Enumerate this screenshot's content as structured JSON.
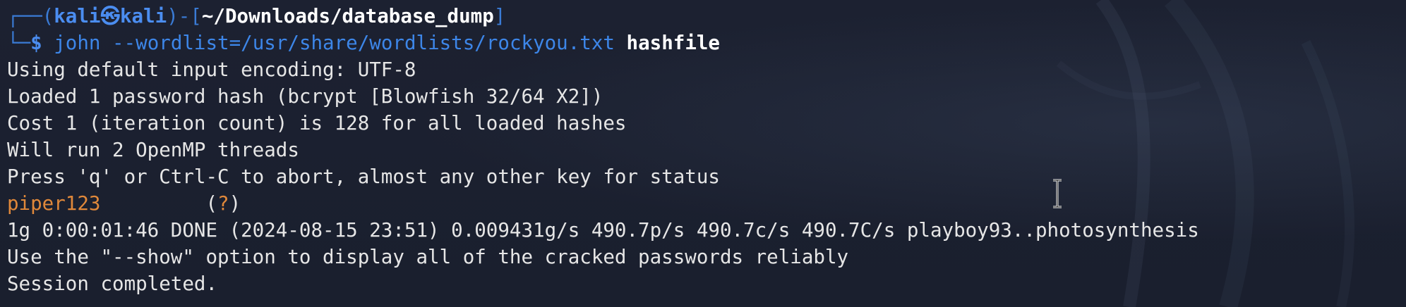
{
  "prompt": {
    "corner_top": "┌──(",
    "user": "kali",
    "at_symbol": "㉿",
    "host": "kali",
    "sep_open": ")-[",
    "path": "~/Downloads/database_dump",
    "sep_close": "]",
    "corner_bottom": "└─",
    "dollar": "$",
    "command": "john",
    "arguments": " --wordlist=/usr/share/wordlists/rockyou.txt ",
    "target": "hashfile"
  },
  "output": {
    "line1": "Using default input encoding: UTF-8",
    "line2": "Loaded 1 password hash (bcrypt [Blowfish 32/64 X2])",
    "line3": "Cost 1 (iteration count) is 128 for all loaded hashes",
    "line4": "Will run 2 OpenMP threads",
    "line5": "Press 'q' or Ctrl-C to abort, almost any other key for status",
    "cracked_password": "piper123",
    "cracked_spacing": "         ",
    "cracked_paren_open": "(",
    "cracked_user": "?",
    "cracked_paren_close": ")",
    "line7": "1g 0:00:01:46 DONE (2024-08-15 23:51) 0.009431g/s 490.7p/s 490.7c/s 490.7C/s playboy93..photosynthesis",
    "line8": "Use the \"--show\" option to display all of the cracked passwords reliably",
    "line9": "Session completed."
  },
  "colors": {
    "background": "#1b2030",
    "prompt_blue": "#3a7bd5",
    "text": "#e6e6e6",
    "password_orange": "#e0883a"
  },
  "icons": {
    "cursor": "text-ibeam-cursor-icon",
    "wallpaper": "kali-dragon-watermark"
  }
}
